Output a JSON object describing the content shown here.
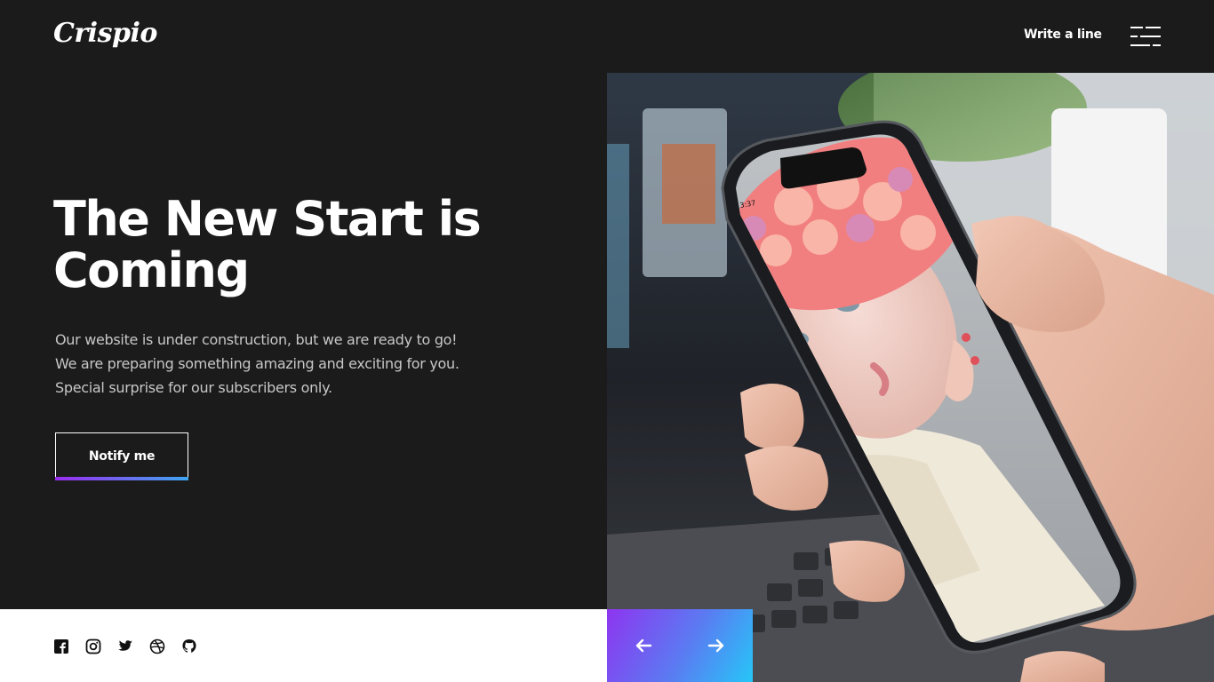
{
  "header": {
    "logo": "Crispio",
    "write_link": "Write a line",
    "menu_icon": "hamburger-menu-icon"
  },
  "hero": {
    "headline": "The New Start is Coming",
    "description": [
      "Our website is under construction, but we are ready to go!",
      "We are preparing something amazing and exciting for you.",
      "Special surprise for our subscribers only."
    ],
    "cta_label": "Notify me",
    "phone_time": "3:37"
  },
  "footer": {
    "socials": [
      "facebook-icon",
      "instagram-icon",
      "twitter-icon",
      "dribbble-icon",
      "github-icon"
    ],
    "prev_icon": "arrow-left-icon",
    "next_icon": "arrow-right-icon"
  },
  "colors": {
    "background": "#1b1b1b",
    "accent_gradient_start": "#9b2cf0",
    "accent_gradient_end": "#26c6f7",
    "text": "#ffffff",
    "muted_text": "#c7c7c7"
  }
}
